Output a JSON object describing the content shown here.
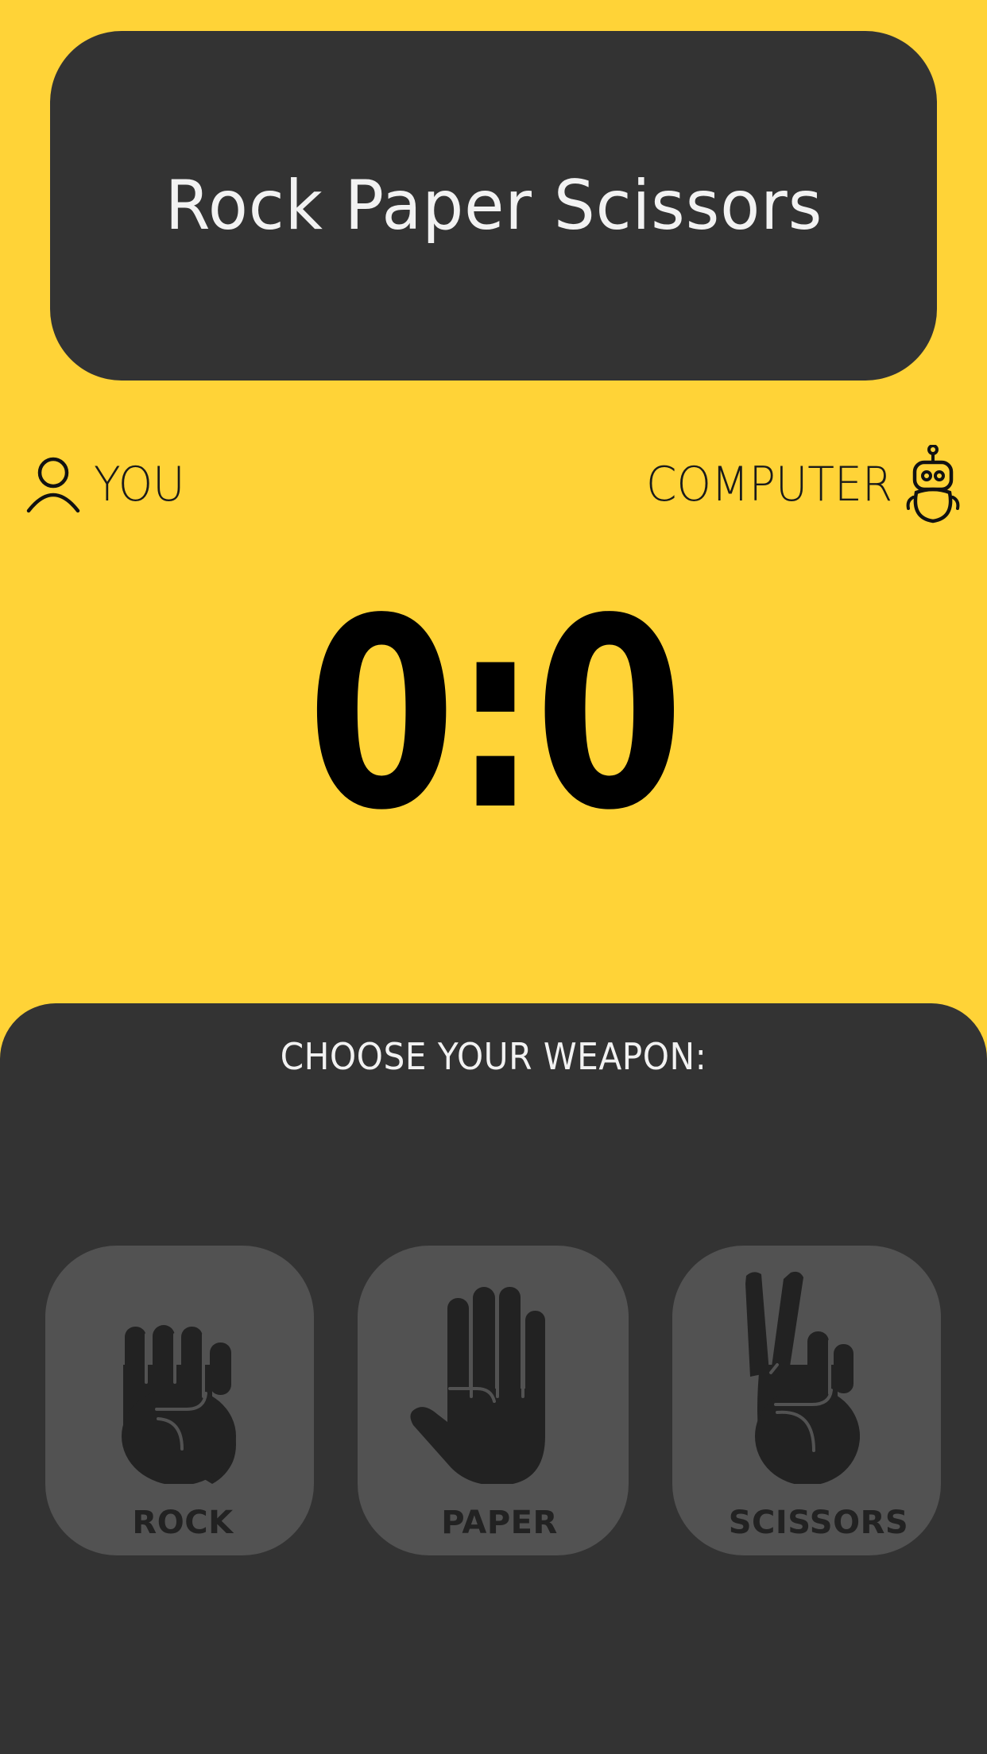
{
  "app": {
    "title": "Rock Paper Scissors",
    "colors": {
      "background": "#FFD337",
      "panel": "#333333",
      "button": "#525252",
      "icon": "#222222"
    }
  },
  "players": {
    "you": {
      "label": "YOU",
      "icon": "user-icon"
    },
    "computer": {
      "label": "COMPUTER",
      "icon": "robot-icon"
    }
  },
  "score": {
    "you": "0",
    "separator": ":",
    "computer": "0"
  },
  "weapons": {
    "prompt": "CHOOSE YOUR WEAPON:",
    "items": [
      {
        "label": "ROCK",
        "icon": "fist-icon"
      },
      {
        "label": "PAPER",
        "icon": "open-hand-icon"
      },
      {
        "label": "SCISSORS",
        "icon": "victory-hand-icon"
      }
    ]
  }
}
